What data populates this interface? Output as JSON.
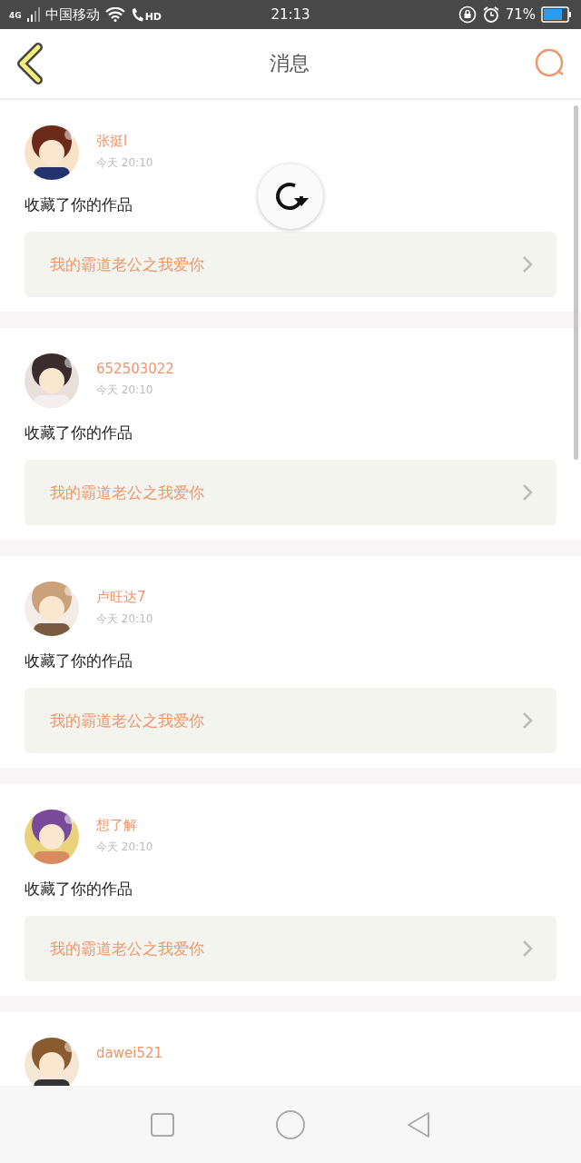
{
  "status_bar": {
    "network": "4G",
    "carrier": "中国移动",
    "call_badge": "HD",
    "time": "21:13",
    "battery": "71%"
  },
  "header": {
    "title": "消息"
  },
  "messages": [
    {
      "name": "张挺l",
      "time": "今天 20:10",
      "action": "收藏了你的作品",
      "work": "我的霸道老公之我爱你"
    },
    {
      "name": "652503022",
      "time": "今天 20:10",
      "action": "收藏了你的作品",
      "work": "我的霸道老公之我爱你"
    },
    {
      "name": "卢旺达7",
      "time": "今天 20:10",
      "action": "收藏了你的作品",
      "work": "我的霸道老公之我爱你"
    },
    {
      "name": "想了解",
      "time": "今天 20:10",
      "action": "收藏了你的作品",
      "work": "我的霸道老公之我爱你"
    },
    {
      "name": "dawei521"
    }
  ]
}
